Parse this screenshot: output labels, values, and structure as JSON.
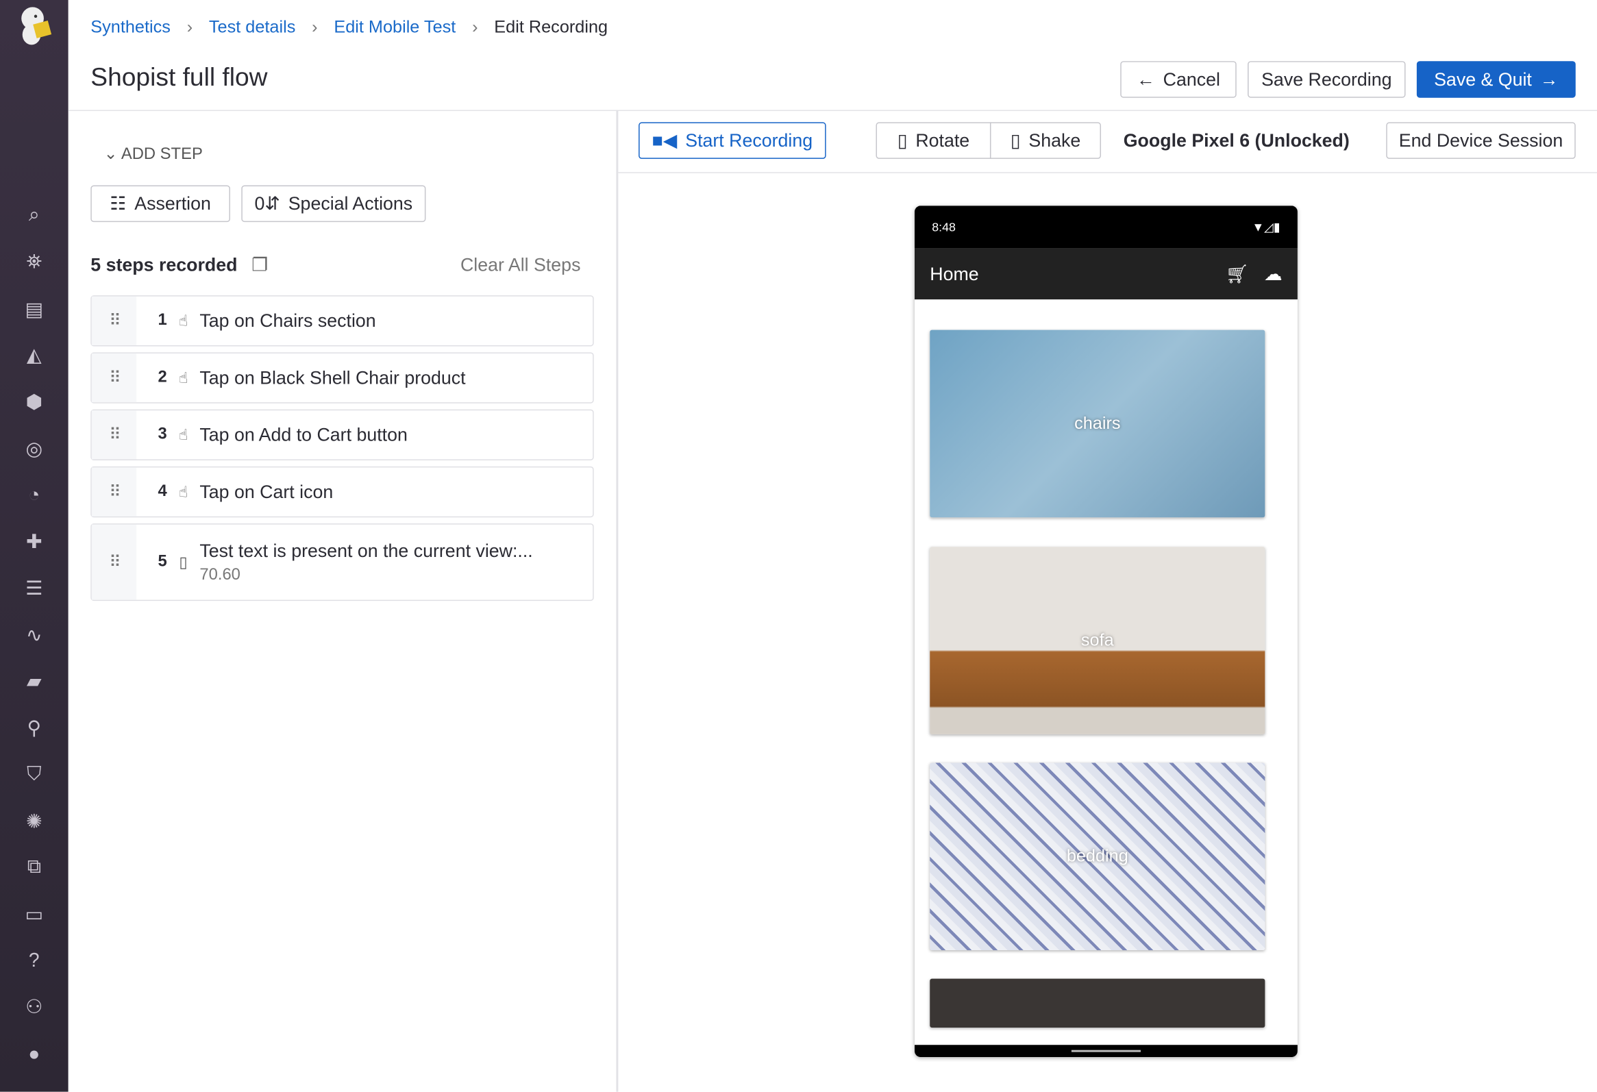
{
  "breadcrumb": [
    {
      "label": "Synthetics"
    },
    {
      "label": "Test details"
    },
    {
      "label": "Edit Mobile Test"
    },
    {
      "label": "Edit Recording"
    }
  ],
  "page_title": "Shopist full flow",
  "header_actions": {
    "cancel": "Cancel",
    "save_recording": "Save Recording",
    "save_quit": "Save & Quit"
  },
  "add_step": {
    "label": "ADD STEP",
    "assertion": "Assertion",
    "special_actions": "Special Actions"
  },
  "steps_header": {
    "count_label": "5 steps recorded",
    "clear_all": "Clear All Steps"
  },
  "steps": [
    {
      "num": "1",
      "icon": "tap-icon",
      "text": "Tap on Chairs section"
    },
    {
      "num": "2",
      "icon": "tap-icon",
      "text": "Tap on Black Shell Chair product"
    },
    {
      "num": "3",
      "icon": "tap-icon",
      "text": "Tap on Add to Cart button"
    },
    {
      "num": "4",
      "icon": "tap-icon",
      "text": "Tap on Cart icon"
    },
    {
      "num": "5",
      "icon": "mobile-icon",
      "text": "Test text is present on the current view:...",
      "sub": "70.60"
    }
  ],
  "device_toolbar": {
    "start_recording": "Start Recording",
    "rotate": "Rotate",
    "shake": "Shake",
    "device": "Google Pixel 6 (Unlocked)",
    "end_session": "End Device Session"
  },
  "phone": {
    "time": "8:48",
    "app_title": "Home",
    "categories": [
      "chairs",
      "sofa",
      "bedding"
    ]
  },
  "colors": {
    "accent": "#1663c7",
    "sidebar": "#2d2734"
  }
}
